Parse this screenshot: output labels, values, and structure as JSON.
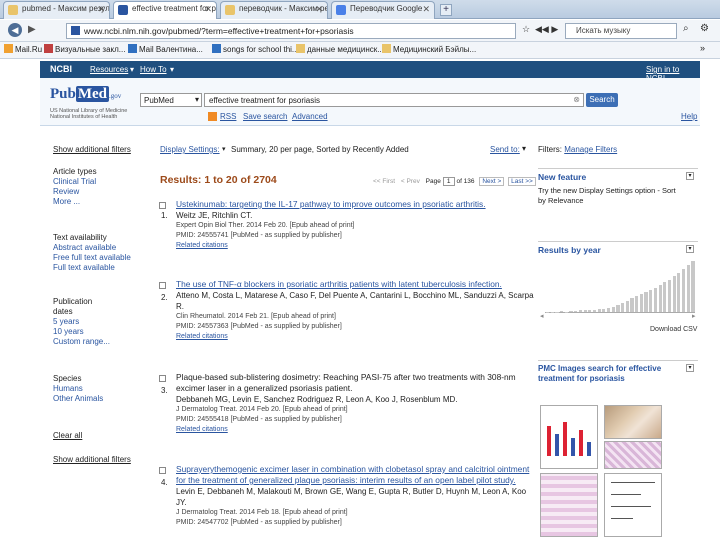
{
  "browser": {
    "tabs": [
      {
        "label": "pubmed - Максим результ",
        "active": false
      },
      {
        "label": "effective treatment for pso",
        "active": true
      },
      {
        "label": "переводчик - Максим резул",
        "active": false
      },
      {
        "label": "Переводчик Google",
        "active": false
      }
    ],
    "address": "www.ncbi.nlm.nih.gov/pubmed/?term=effective+treatment+for+psoriasis",
    "music_search": "Искать музыку",
    "bookmarks": [
      "Mail.Ru",
      "Визуальные закл...",
      "Mail Валентина...",
      "songs for school thi...",
      "данные медицинск...",
      "Медицинский Бэйлы..."
    ]
  },
  "ncbi": {
    "logo": "NCBI",
    "resources": "Resources",
    "howto": "How To",
    "signin": "Sign in to NCBI"
  },
  "pubmed": {
    "logo_pub": "Pub",
    "logo_med": "Med",
    "logo_gov": ".gov",
    "lib_line1": "US National Library of Medicine",
    "lib_line2": "National Institutes of Health",
    "db_select": "PubMed",
    "query": "effective treatment for psoriasis",
    "search_button": "Search",
    "rss": "RSS",
    "save_search": "Save search",
    "advanced": "Advanced",
    "help": "Help"
  },
  "left_filters": {
    "show_additional": "Show additional filters",
    "article_types": [
      "Article types",
      "Clinical Trial",
      "Review",
      "More ..."
    ],
    "text_availability": [
      "Text availability",
      "Abstract available",
      "Free full text available",
      "Full text available"
    ],
    "publication_dates": [
      "Publication",
      "dates",
      "5 years",
      "10 years",
      "Custom range..."
    ],
    "species": [
      "Species",
      "Humans",
      "Other Animals"
    ],
    "clear_all": "Clear all",
    "show_additional_bottom": "Show additional filters"
  },
  "toolbar": {
    "display_settings": "Display Settings:",
    "display_value": "Summary, 20 per page, Sorted by Recently Added",
    "send_to": "Send to:"
  },
  "results": {
    "count_label": "Results: 1 to 20 of 2704",
    "first": "<< First",
    "prev": "< Prev",
    "page_label": "Page",
    "page_value": "1",
    "of_pages": "of 136",
    "next": "Next >",
    "last": "Last >>",
    "items": [
      {
        "num": "1.",
        "title": "Ustekinumab: targeting the IL-17 pathway to improve outcomes in psoriatic arthritis.",
        "authors": "Weitz JE, Ritchlin CT.",
        "journal": "Expert Opin Biol Ther. 2014 Feb 20. [Epub ahead of print]",
        "pmid": "PMID: 24555741 [PubMed - as supplied by publisher]",
        "related": "Related citations"
      },
      {
        "num": "2.",
        "title": "The use of TNF-α blockers in psoriatic arthritis patients with latent tuberculosis infection.",
        "authors": "Atteno M, Costa L, Matarese A, Caso F, Del Puente A, Cantarini L, Bocchino ML, Sanduzzi A, Scarpa R.",
        "journal": "Clin Rheumatol. 2014 Feb 21. [Epub ahead of print]",
        "pmid": "PMID: 24557363 [PubMed - as supplied by publisher]",
        "related": "Related citations"
      },
      {
        "num": "3.",
        "title": "Plaque-based sub-blistering dosimetry: Reaching PASI-75 after two treatments with 308-nm excimer laser in a generalized psoriasis patient.",
        "authors": "Debbaneh MG, Levin E, Sanchez Rodriguez R, Leon A, Koo J, Rosenblum MD.",
        "journal": "J Dermatolog Treat. 2014 Feb 20. [Epub ahead of print]",
        "pmid": "PMID: 24555418 [PubMed - as supplied by publisher]",
        "related": "Related citations"
      },
      {
        "num": "4.",
        "title": "Suprayerythemogenic excimer laser in combination with clobetasol spray and calcitriol ointment for the treatment of generalized plaque psoriasis: interim results of an open label pilot study.",
        "authors": "Levin E, Debbaneh M, Malakouti M, Brown GE, Wang E, Gupta R, Butler D, Huynh M, Leon A, Koo JY.",
        "journal": "J Dermatolog Treat. 2014 Feb 18. [Epub ahead of print]",
        "pmid": "PMID: 24547702 [PubMed - as supplied by publisher]",
        "related": ""
      }
    ]
  },
  "right_panel": {
    "filters_label": "Filters:",
    "manage_filters": "Manage Filters",
    "new_feature": "New feature",
    "new_feature_text": "Try the new Display Settings option - Sort by Relevance",
    "results_by_year": "Results by year",
    "download_csv": "Download CSV",
    "year_counts": [
      1,
      1,
      1,
      2,
      1,
      2,
      2,
      3,
      3,
      4,
      4,
      5,
      6,
      8,
      10,
      14,
      18,
      22,
      28,
      32,
      36,
      40,
      44,
      48,
      52,
      58,
      62,
      70,
      76,
      84,
      92,
      100
    ],
    "pmc_title": "PMC Images search for effective treatment for psoriasis"
  }
}
